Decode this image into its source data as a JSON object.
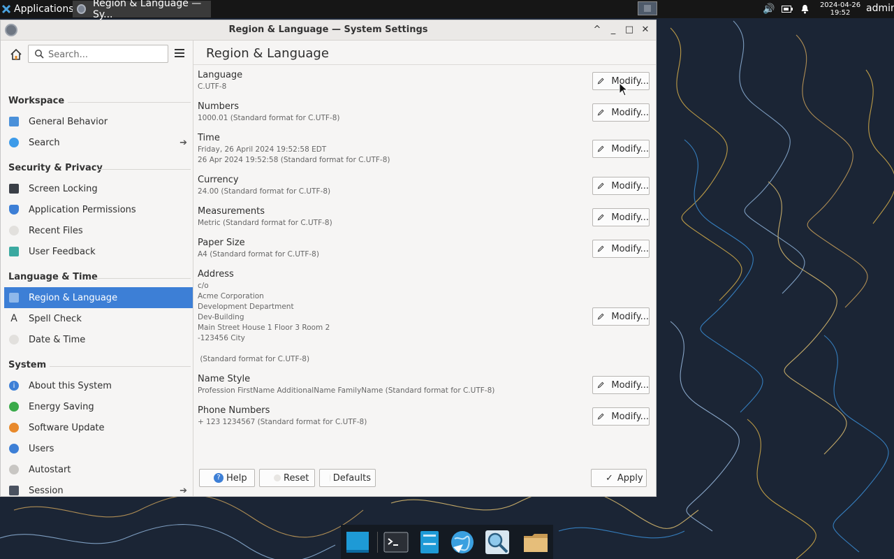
{
  "taskbar": {
    "applications_label": "Applications",
    "active_task_label": "Region & Language — Sy...",
    "clock_date": "2024-04-26",
    "clock_time": "19:52",
    "user": "admin"
  },
  "window": {
    "title": "Region & Language — System Settings",
    "controls": {
      "shade": "^",
      "minimize": "_",
      "maximize": "□",
      "close": "✕"
    }
  },
  "sidebar": {
    "search_placeholder": "Search...",
    "categories": [
      {
        "title": "Workspace",
        "items": [
          {
            "label": "General Behavior",
            "icon": "general-behavior-icon"
          },
          {
            "label": "Search",
            "icon": "search-icon",
            "has_arrow": true
          }
        ]
      },
      {
        "title": "Security & Privacy",
        "items": [
          {
            "label": "Screen Locking",
            "icon": "screen-locking-icon"
          },
          {
            "label": "Application Permissions",
            "icon": "shield-icon"
          },
          {
            "label": "Recent Files",
            "icon": "recent-files-icon"
          },
          {
            "label": "User Feedback",
            "icon": "feedback-icon"
          }
        ]
      },
      {
        "title": "Language & Time",
        "items": [
          {
            "label": "Region & Language",
            "icon": "flag-icon",
            "selected": true
          },
          {
            "label": "Spell Check",
            "icon": "spell-check-icon"
          },
          {
            "label": "Date & Time",
            "icon": "clock-icon"
          }
        ]
      },
      {
        "title": "System",
        "items": [
          {
            "label": "About this System",
            "icon": "info-icon"
          },
          {
            "label": "Energy Saving",
            "icon": "energy-icon"
          },
          {
            "label": "Software Update",
            "icon": "update-icon"
          },
          {
            "label": "Users",
            "icon": "users-icon"
          },
          {
            "label": "Autostart",
            "icon": "autostart-icon"
          },
          {
            "label": "Session",
            "icon": "session-icon",
            "has_arrow": true
          }
        ]
      }
    ]
  },
  "main": {
    "title": "Region & Language",
    "modify_label": "Modify...",
    "settings": [
      {
        "label": "Language",
        "value": "C.UTF-8"
      },
      {
        "label": "Numbers",
        "value": "1000.01 (Standard format for C.UTF-8)"
      },
      {
        "label": "Time",
        "value": "Friday, 26 April 2024 19:52:58 EDT\n26 Apr 2024 19:52:58 (Standard format for C.UTF-8)"
      },
      {
        "label": "Currency",
        "value": "24.00 (Standard format for C.UTF-8)"
      },
      {
        "label": "Measurements",
        "value": "Metric (Standard format for C.UTF-8)"
      },
      {
        "label": "Paper Size",
        "value": "A4 (Standard format for C.UTF-8)"
      },
      {
        "label": "Address",
        "value": "c/o\nAcme Corporation\nDevelopment Department\nDev-Building\nMain Street House 1 Floor 3 Room 2\n-123456 City\n\n (Standard format for C.UTF-8)"
      },
      {
        "label": "Name Style",
        "value": "Profession FirstName AdditionalName FamilyName (Standard format for C.UTF-8)"
      },
      {
        "label": "Phone Numbers",
        "value": "+ 123 1234567 (Standard format for C.UTF-8)"
      }
    ],
    "footer": {
      "help": "Help",
      "reset": "Reset",
      "defaults": "Defaults",
      "apply": "Apply"
    }
  },
  "colors": {
    "accent": "#3d7fd6",
    "window_bg": "#f6f5f4",
    "desktop_bg": "#1b2535"
  }
}
